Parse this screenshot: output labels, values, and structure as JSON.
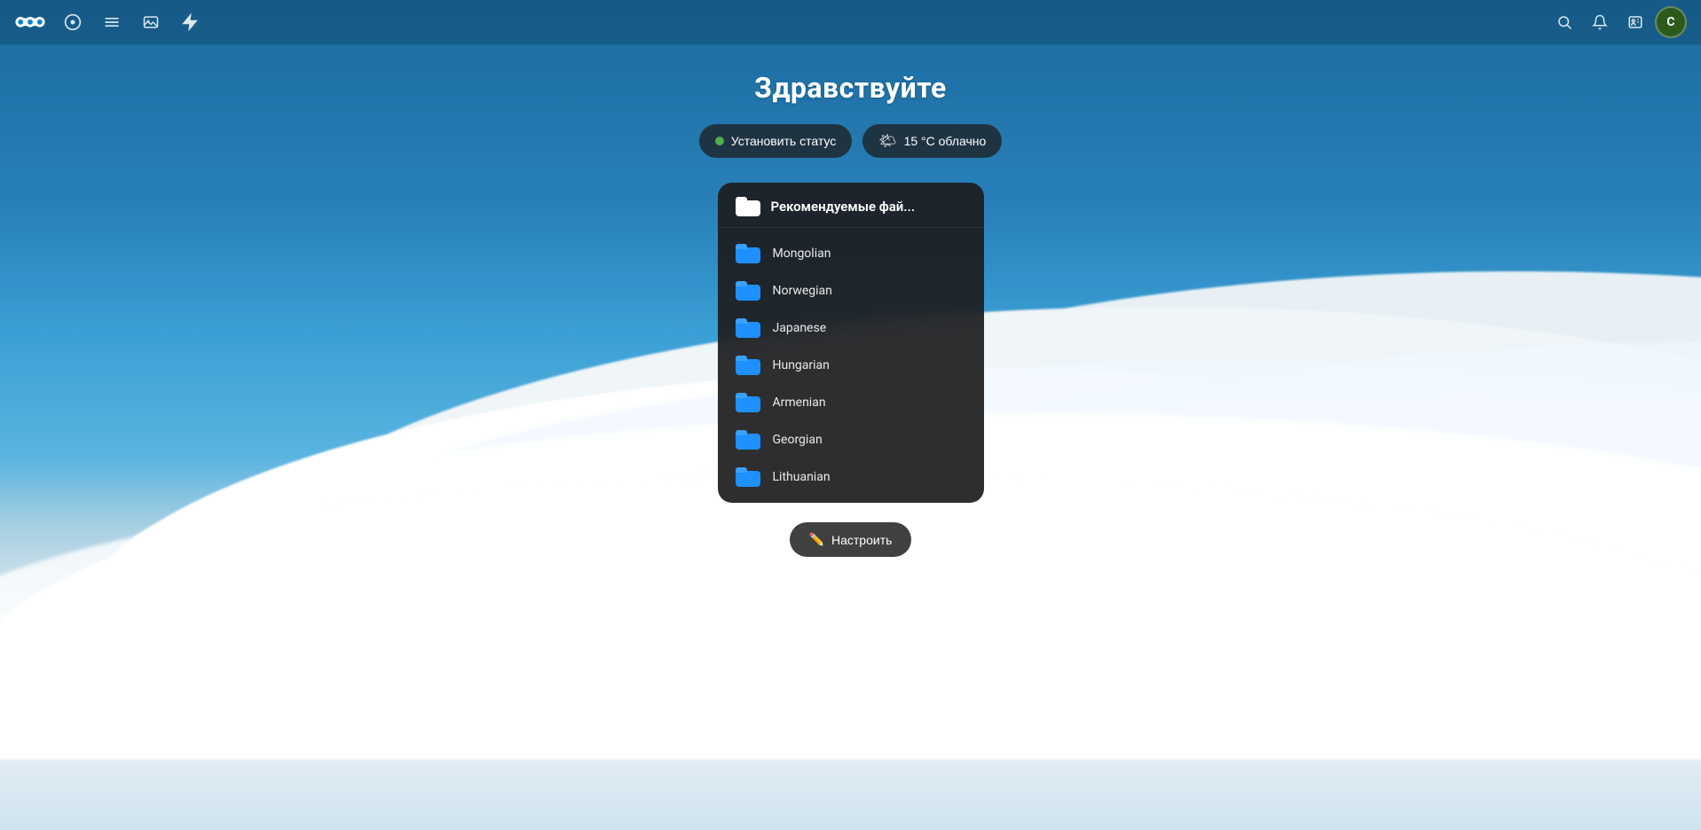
{
  "app": {
    "name": "Nextcloud"
  },
  "navbar": {
    "logo_alt": "Nextcloud logo",
    "nav_items": [
      {
        "id": "dashboard",
        "icon": "circle-icon",
        "label": "Dashboard"
      },
      {
        "id": "files",
        "icon": "folder-icon",
        "label": "Files"
      },
      {
        "id": "photos",
        "icon": "image-icon",
        "label": "Photos"
      },
      {
        "id": "activity",
        "icon": "activity-icon",
        "label": "Activity"
      }
    ],
    "right_items": [
      {
        "id": "search",
        "icon": "search-icon",
        "label": "Search"
      },
      {
        "id": "notifications",
        "icon": "bell-icon",
        "label": "Notifications"
      },
      {
        "id": "contacts",
        "icon": "contacts-icon",
        "label": "Contacts"
      },
      {
        "id": "avatar",
        "label": "C",
        "aria": "User menu"
      }
    ]
  },
  "main": {
    "greeting": "Здравствуйте",
    "status_button": "Установить статус",
    "weather_button": "15 °С облачно",
    "file_card": {
      "header_icon": "folder",
      "title": "Рекомендуемые фай...",
      "items": [
        {
          "name": "Mongolian"
        },
        {
          "name": "Norwegian"
        },
        {
          "name": "Japanese"
        },
        {
          "name": "Hungarian"
        },
        {
          "name": "Armenian"
        },
        {
          "name": "Georgian"
        },
        {
          "name": "Lithuanian"
        }
      ]
    },
    "customize_button": "Настроить"
  },
  "colors": {
    "background_top": "#1a6a9e",
    "background_bottom": "#4a9fc8",
    "card_bg": "rgba(28, 28, 30, 0.92)",
    "folder_blue": "#1e90ff",
    "status_green": "#4caf50",
    "text_white": "#ffffff"
  }
}
